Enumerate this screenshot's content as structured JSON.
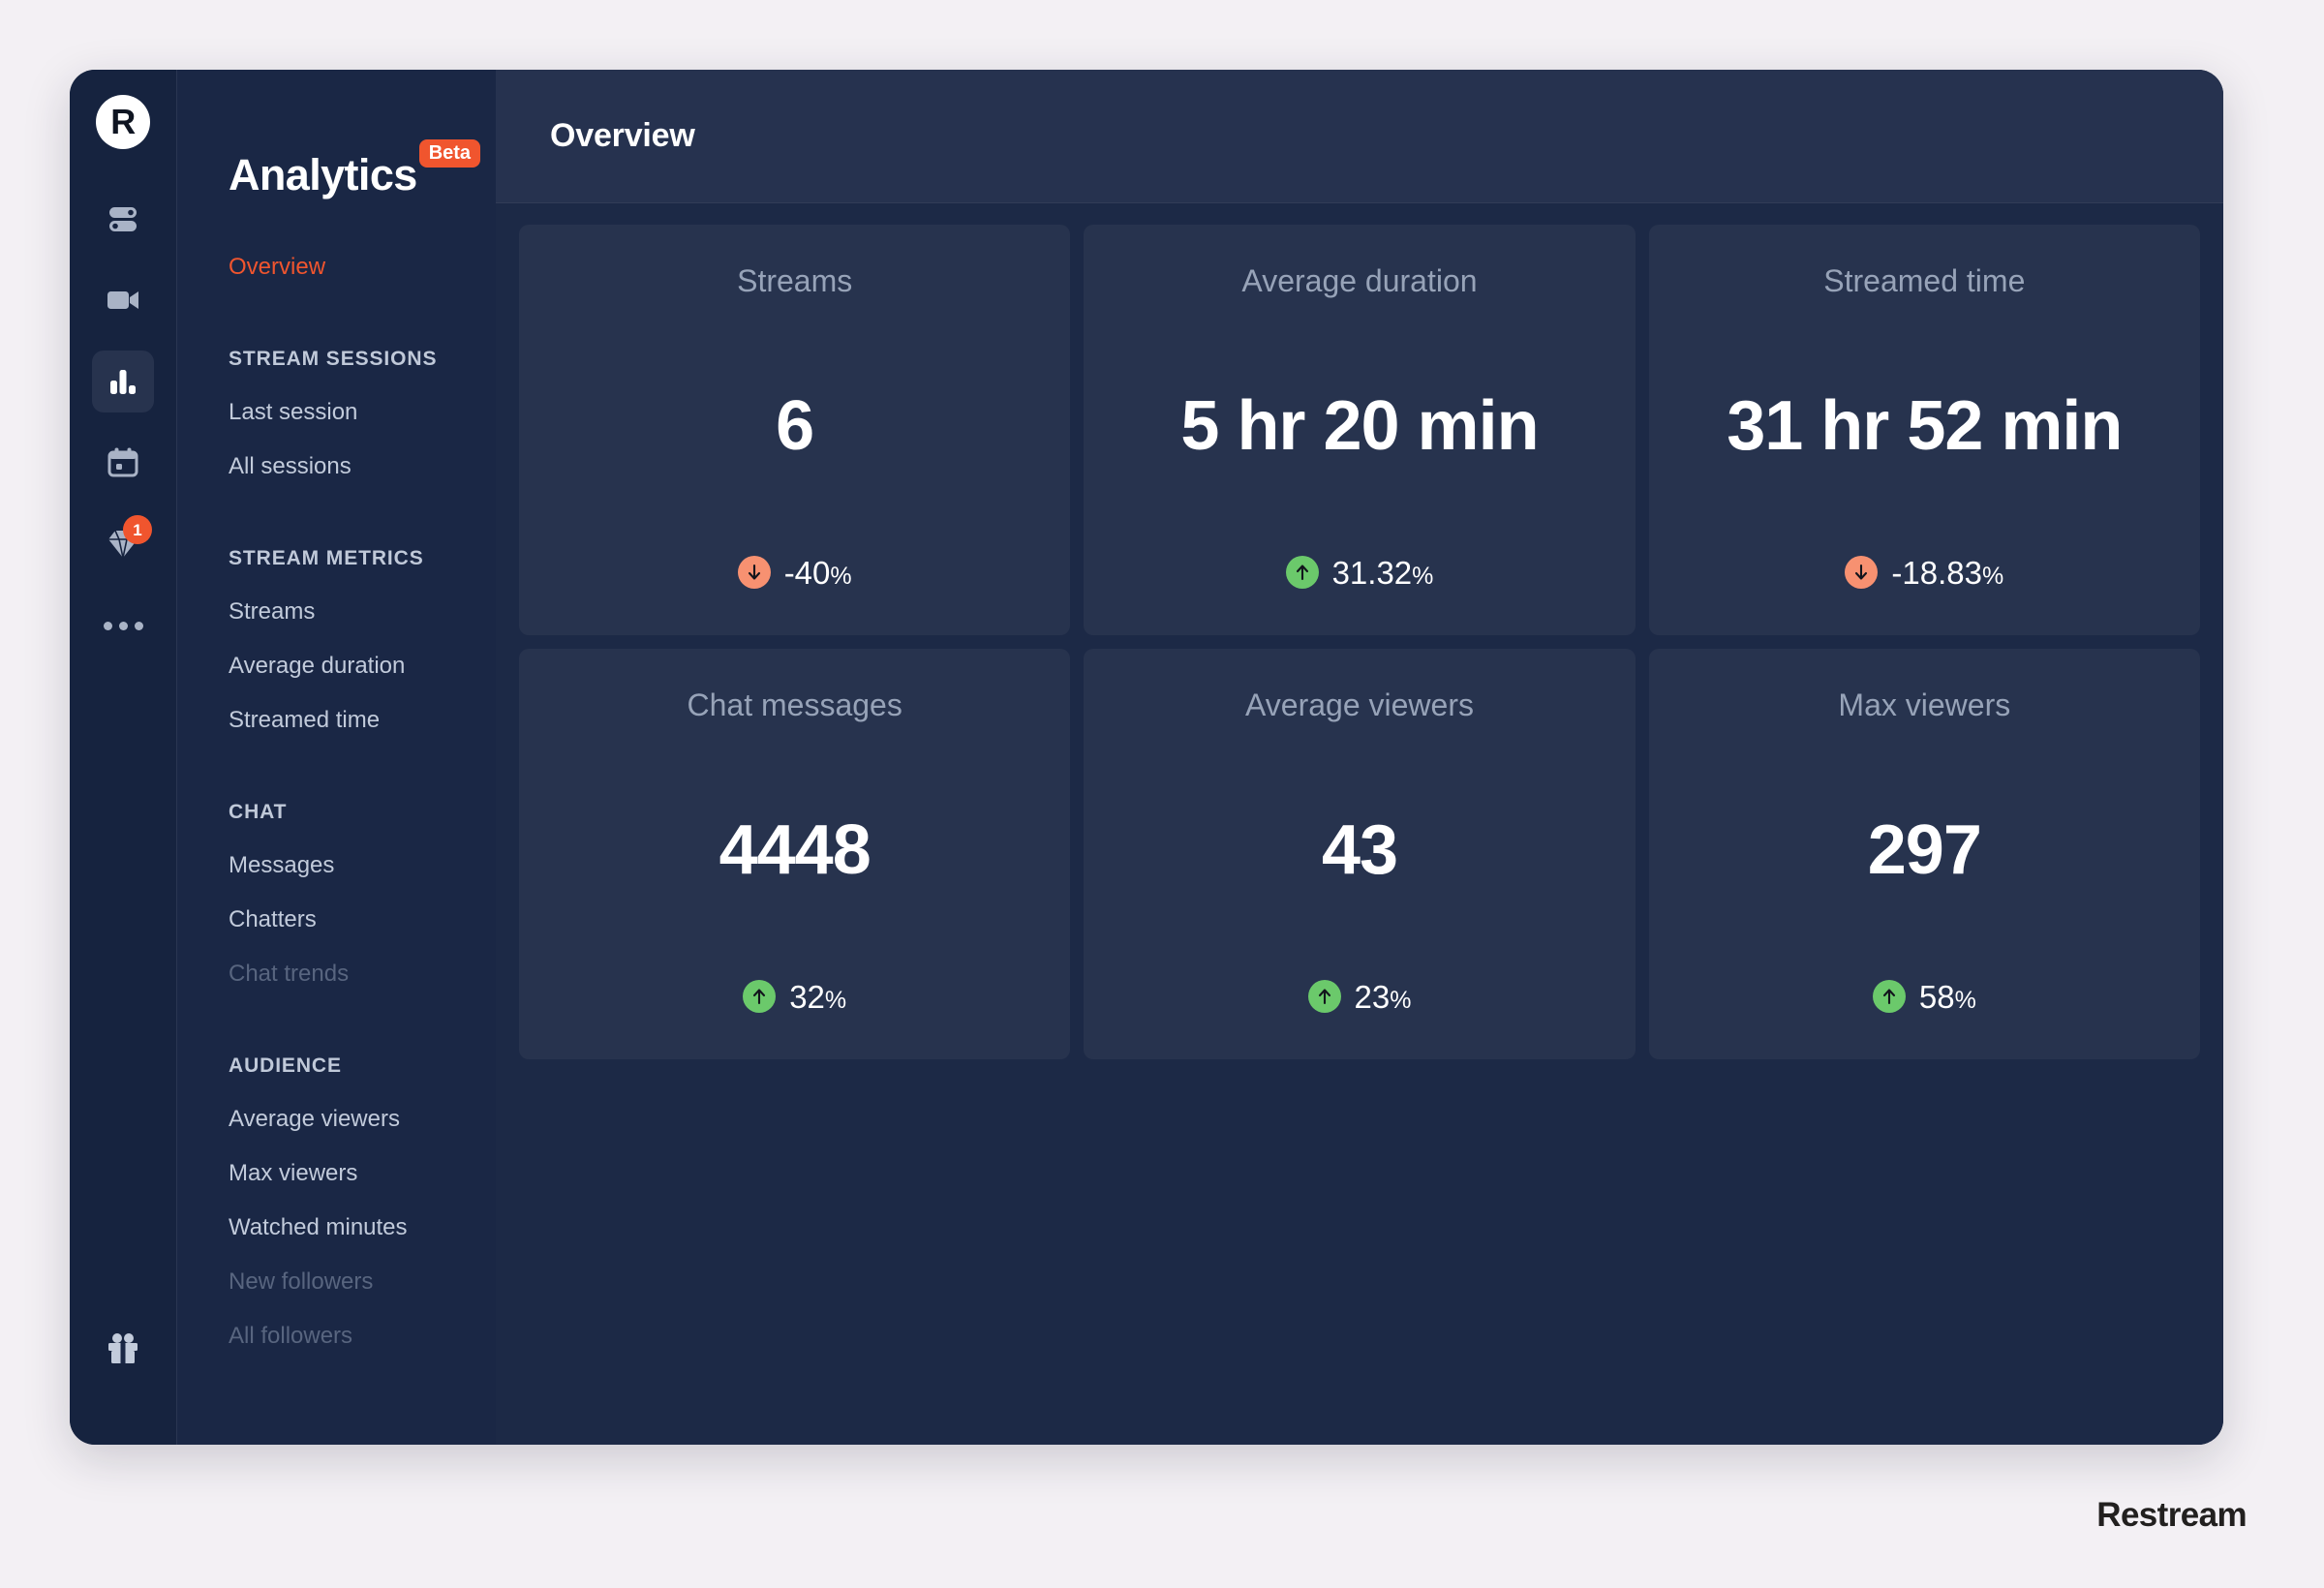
{
  "brand": {
    "logo_letter": "R",
    "wordmark": "Restream"
  },
  "icon_rail": {
    "items": [
      {
        "name": "sliders-icon",
        "label": "Settings toggles",
        "badge": null,
        "active": false
      },
      {
        "name": "video-camera-icon",
        "label": "Video",
        "badge": null,
        "active": false
      },
      {
        "name": "bar-chart-icon",
        "label": "Analytics",
        "badge": null,
        "active": true
      },
      {
        "name": "calendar-icon",
        "label": "Schedule",
        "badge": null,
        "active": false
      },
      {
        "name": "diamond-icon",
        "label": "Upgrade",
        "badge": "1",
        "active": false
      },
      {
        "name": "more-dots-icon",
        "label": "More",
        "badge": null,
        "active": false
      }
    ],
    "bottom_item": {
      "name": "gift-icon",
      "label": "Rewards"
    }
  },
  "sidebar": {
    "title": "Analytics",
    "badge": "Beta",
    "current_item": "Overview",
    "sections": [
      {
        "title": null,
        "items": [
          {
            "label": "Overview",
            "state": "current"
          }
        ]
      },
      {
        "title": "STREAM SESSIONS",
        "items": [
          {
            "label": "Last session",
            "state": "normal"
          },
          {
            "label": "All sessions",
            "state": "normal"
          }
        ]
      },
      {
        "title": "STREAM METRICS",
        "items": [
          {
            "label": "Streams",
            "state": "normal"
          },
          {
            "label": "Average duration",
            "state": "normal"
          },
          {
            "label": "Streamed time",
            "state": "normal"
          }
        ]
      },
      {
        "title": "CHAT",
        "items": [
          {
            "label": "Messages",
            "state": "normal"
          },
          {
            "label": "Chatters",
            "state": "normal"
          },
          {
            "label": "Chat trends",
            "state": "disabled"
          }
        ]
      },
      {
        "title": "AUDIENCE",
        "items": [
          {
            "label": "Average viewers",
            "state": "normal"
          },
          {
            "label": "Max viewers",
            "state": "normal"
          },
          {
            "label": "Watched minutes",
            "state": "normal"
          },
          {
            "label": "New followers",
            "state": "disabled"
          },
          {
            "label": "All followers",
            "state": "disabled"
          }
        ]
      }
    ]
  },
  "header": {
    "title": "Overview"
  },
  "cards": [
    {
      "label": "Streams",
      "value": "6",
      "delta_value": "-40",
      "delta_unit": "%",
      "direction": "down",
      "direction_color": "#f79171"
    },
    {
      "label": "Average duration",
      "value": "5 hr 20 min",
      "delta_value": "31.32",
      "delta_unit": "%",
      "direction": "up",
      "direction_color": "#6bc96b"
    },
    {
      "label": "Streamed time",
      "value": "31 hr 52 min",
      "delta_value": "-18.83",
      "delta_unit": "%",
      "direction": "down",
      "direction_color": "#f79171"
    },
    {
      "label": "Chat messages",
      "value": "4448",
      "delta_value": "32",
      "delta_unit": "%",
      "direction": "up",
      "direction_color": "#6bc96b"
    },
    {
      "label": "Average viewers",
      "value": "43",
      "delta_value": "23",
      "delta_unit": "%",
      "direction": "up",
      "direction_color": "#6bc96b"
    },
    {
      "label": "Max viewers",
      "value": "297",
      "delta_value": "58",
      "delta_unit": "%",
      "direction": "up",
      "direction_color": "#6bc96b"
    }
  ],
  "colors": {
    "accent": "#f0552e",
    "page_background": "#f3f0f4",
    "app_background": "#16233f",
    "panel_background": "#1c2946",
    "card_background": "#27334e",
    "positive": "#6bc96b",
    "negative": "#f79171"
  }
}
